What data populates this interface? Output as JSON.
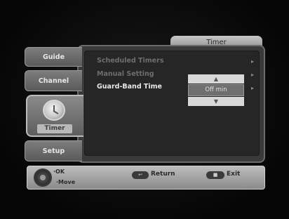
{
  "title": "Timer",
  "side_tabs": {
    "guide": "Guide",
    "channel": "Channel",
    "timer": "Timer",
    "setup": "Setup"
  },
  "menu": {
    "items": [
      {
        "label": "Scheduled Timers",
        "selected": false
      },
      {
        "label": "Manual Setting",
        "selected": false
      },
      {
        "label": "Guard-Band Time",
        "selected": true
      }
    ]
  },
  "dropdown": {
    "value": "Off min"
  },
  "footer": {
    "ok": "OK",
    "move": "Move",
    "return": "Return",
    "exit": "Exit"
  },
  "colors": {
    "background": "#0a0a0a",
    "panel": "#262626",
    "selected_text": "#e8e8e8",
    "dim_text": "#6e6e6e"
  },
  "icons": {
    "timer_tab": "clock-icon",
    "dpad": "dpad-icon",
    "return_button": "return-button-icon",
    "exit_button": "exit-button-icon"
  }
}
